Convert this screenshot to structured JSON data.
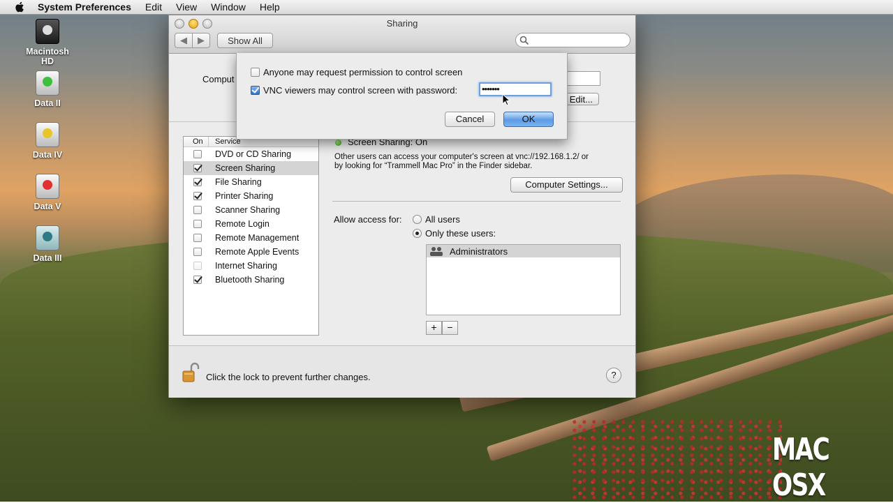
{
  "menubar": {
    "app_name": "System Preferences",
    "items": [
      "Edit",
      "View",
      "Window",
      "Help"
    ]
  },
  "desktop_icons": [
    {
      "label": "Macintosh HD",
      "icon": "internal-disk-icon"
    },
    {
      "label": "Data II",
      "icon": "external-disk-icon"
    },
    {
      "label": "Data IV",
      "icon": "external-disk-icon"
    },
    {
      "label": "Data V",
      "icon": "external-disk-icon"
    },
    {
      "label": "Data III",
      "icon": "time-machine-disk-icon"
    }
  ],
  "window": {
    "title": "Sharing",
    "show_all_label": "Show All",
    "search_placeholder": "",
    "computer_label": "Comput",
    "edit_label": "Edit...",
    "list_header": {
      "on": "On",
      "service": "Service"
    },
    "services": [
      {
        "label": "DVD or CD Sharing",
        "checked": false,
        "selected": false
      },
      {
        "label": "Screen Sharing",
        "checked": true,
        "selected": true
      },
      {
        "label": "File Sharing",
        "checked": true,
        "selected": false
      },
      {
        "label": "Printer Sharing",
        "checked": true,
        "selected": false
      },
      {
        "label": "Scanner Sharing",
        "checked": false,
        "selected": false
      },
      {
        "label": "Remote Login",
        "checked": false,
        "selected": false
      },
      {
        "label": "Remote Management",
        "checked": false,
        "selected": false
      },
      {
        "label": "Remote Apple Events",
        "checked": false,
        "selected": false
      },
      {
        "label": "Internet Sharing",
        "checked": false,
        "selected": false,
        "disabled": true
      },
      {
        "label": "Bluetooth Sharing",
        "checked": true,
        "selected": false
      }
    ],
    "status": "Screen Sharing: On",
    "description_line1": "Other users can access your computer's screen at vnc://192.168.1.2/ or",
    "description_line2": "by looking for “Trammell Mac Pro” in the Finder sidebar.",
    "computer_settings_label": "Computer Settings...",
    "allow_access_label": "Allow access for:",
    "access_options": [
      {
        "label": "All users",
        "selected": false
      },
      {
        "label": "Only these users:",
        "selected": true
      }
    ],
    "users": [
      "Administrators"
    ],
    "add_label": "+",
    "remove_label": "−",
    "lock_text": "Click the lock to prevent further changes.",
    "help_label": "?"
  },
  "sheet": {
    "option1_label": "Anyone may request permission to control screen",
    "option1_checked": false,
    "option2_label": "VNC viewers may control screen with password:",
    "option2_checked": true,
    "password_value": "•••••••",
    "cancel_label": "Cancel",
    "ok_label": "OK"
  },
  "watermark": "MAC OSX",
  "colors": {
    "accent_blue": "#5d9be4",
    "status_green": "#31a30e",
    "selection_gray": "#d4d4d4"
  }
}
